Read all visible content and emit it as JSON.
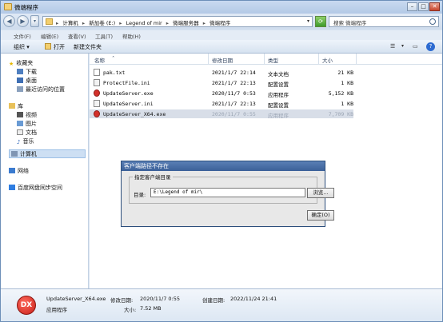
{
  "window": {
    "title": "微端程序"
  },
  "address": {
    "crumbs": [
      "计算机",
      "新加卷 (E:)",
      "Legend of mir",
      "微端服务器",
      "微端程序"
    ],
    "search_placeholder": "搜索 微端程序"
  },
  "menu": [
    "文件(F)",
    "编辑(E)",
    "查看(V)",
    "工具(T)",
    "帮助(H)"
  ],
  "toolbar": {
    "organize": "组织 ▾",
    "open": "打开",
    "new_folder": "新建文件夹"
  },
  "sidebar": {
    "favorites": "收藏夹",
    "downloads": "下载",
    "desktop": "桌面",
    "recent": "最近访问的位置",
    "libraries": "库",
    "videos": "视频",
    "pictures": "图片",
    "documents": "文档",
    "music": "音乐",
    "computer": "计算机",
    "network": "网络",
    "baidu": "百度网盘同步空间"
  },
  "columns": {
    "name": "名称",
    "date": "修改日期",
    "type": "类型",
    "size": "大小"
  },
  "files": [
    {
      "name": "pak.txt",
      "date": "2021/1/7 22:14",
      "type": "文本文档",
      "size": "21 KB",
      "icon": "doc"
    },
    {
      "name": "ProtectFile.ini",
      "date": "2021/1/7 22:13",
      "type": "配置设置",
      "size": "1 KB",
      "icon": "ini"
    },
    {
      "name": "UpdateServer.exe",
      "date": "2020/11/7 0:53",
      "type": "应用程序",
      "size": "5,152 KB",
      "icon": "exe"
    },
    {
      "name": "UpdateServer.ini",
      "date": "2021/1/7 22:13",
      "type": "配置设置",
      "size": "1 KB",
      "icon": "ini"
    },
    {
      "name": "UpdateServer_X64.exe",
      "date": "2020/11/7 0:55",
      "type": "应用程序",
      "size": "7,709 KB",
      "icon": "exe"
    }
  ],
  "dialog": {
    "title": "客户端路径不存在",
    "group_label": "指定客户端目录",
    "dir_label": "目录:",
    "dir_value": "E:\\Legend of mir\\",
    "browse": "浏览...",
    "ok": "确定(O)"
  },
  "details": {
    "icon_text": "DX",
    "filename": "UpdateServer_X64.exe",
    "modified_label": "修改日期:",
    "modified_value": "2020/11/7 0:55",
    "created_label": "创建日期:",
    "created_value": "2022/11/24 21:41",
    "type": "应用程序",
    "size_label": "大小:",
    "size_value": "7.52 MB"
  }
}
